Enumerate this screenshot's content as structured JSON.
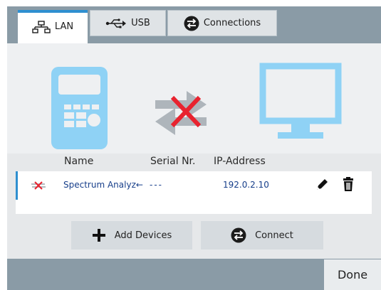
{
  "tabs": [
    {
      "label": "LAN",
      "icon": "lan-icon",
      "active": true
    },
    {
      "label": "USB",
      "icon": "usb-icon",
      "active": false
    },
    {
      "label": "Connections",
      "icon": "connections-icon",
      "active": false
    }
  ],
  "graphic": {
    "device_icon": "handheld-analyzer-icon",
    "status_icon": "disconnected-arrows-icon",
    "monitor_icon": "monitor-icon"
  },
  "table": {
    "headers": [
      "Name",
      "Serial Nr.",
      "IP-Address"
    ],
    "rows": [
      {
        "status_icon": "disconnected-icon",
        "name": "Spectrum Analyz←",
        "serial": "---",
        "ip": "192.0.2.10"
      }
    ]
  },
  "buttons": {
    "add": "Add Devices",
    "connect": "Connect",
    "done": "Done"
  },
  "colors": {
    "accent": "#2e8fd0",
    "device_blue": "#8fd2f5",
    "error_red": "#e8232f"
  }
}
